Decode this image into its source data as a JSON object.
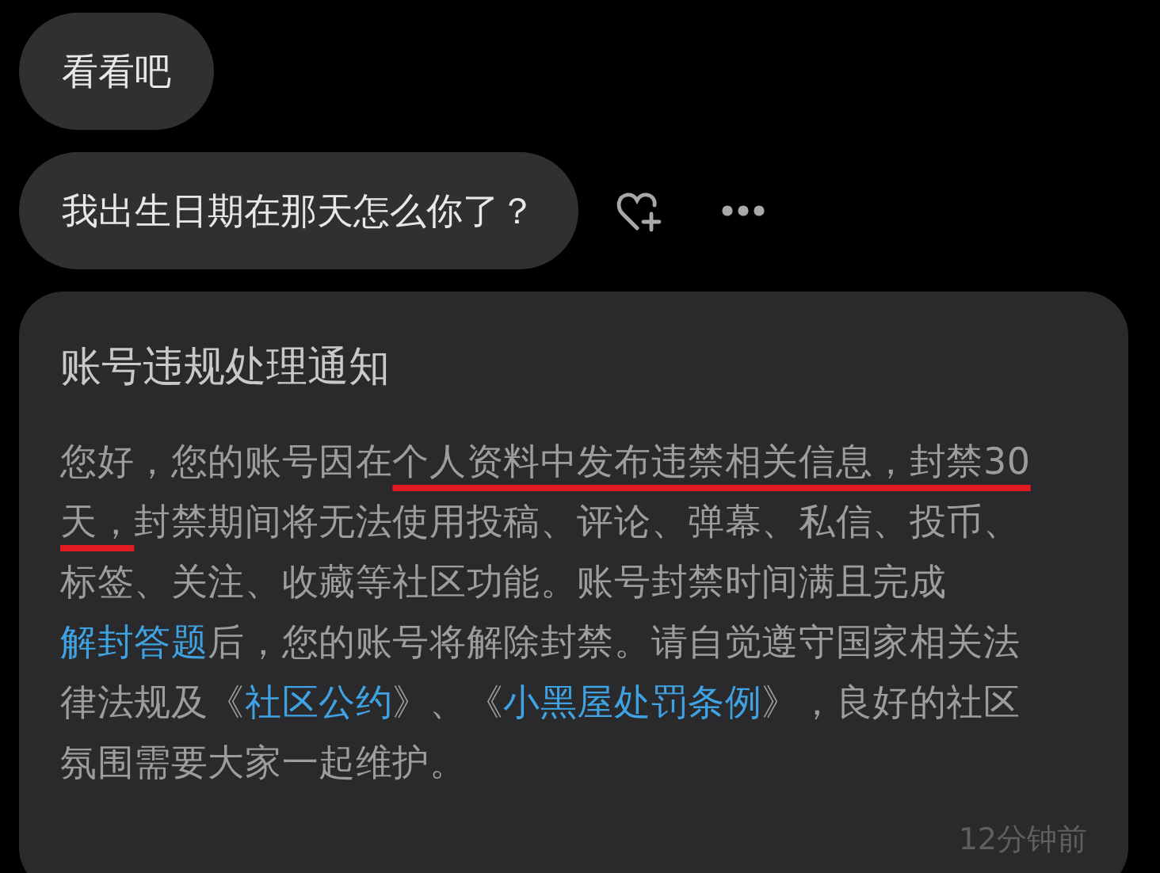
{
  "messages": [
    {
      "text": "看看吧",
      "actions": false
    },
    {
      "text": "我出生日期在那天怎么你了？",
      "actions": true
    }
  ],
  "notice": {
    "title": "账号违规处理通知",
    "body": [
      {
        "kind": "text",
        "text": "您好，您的账号因在"
      },
      {
        "kind": "underlined",
        "text": "个人资料中发布违禁相关信息，封禁30天，"
      },
      {
        "kind": "text",
        "text": "封禁期间将无法使用投稿、评论、弹幕、私信、投币、标签、关注、收藏等社区功能。账号封禁时间满且完成"
      },
      {
        "kind": "link",
        "text": "解封答题"
      },
      {
        "kind": "text",
        "text": "后，您的账号将解除封禁。请自觉遵守国家相关法律法规及《"
      },
      {
        "kind": "link",
        "text": "社区公约"
      },
      {
        "kind": "text",
        "text": "》、《"
      },
      {
        "kind": "link",
        "text": "小黑屋处罚条例"
      },
      {
        "kind": "text",
        "text": "》，良好的社区氛围需要大家一起维护。"
      }
    ],
    "time": "12分钟前"
  }
}
